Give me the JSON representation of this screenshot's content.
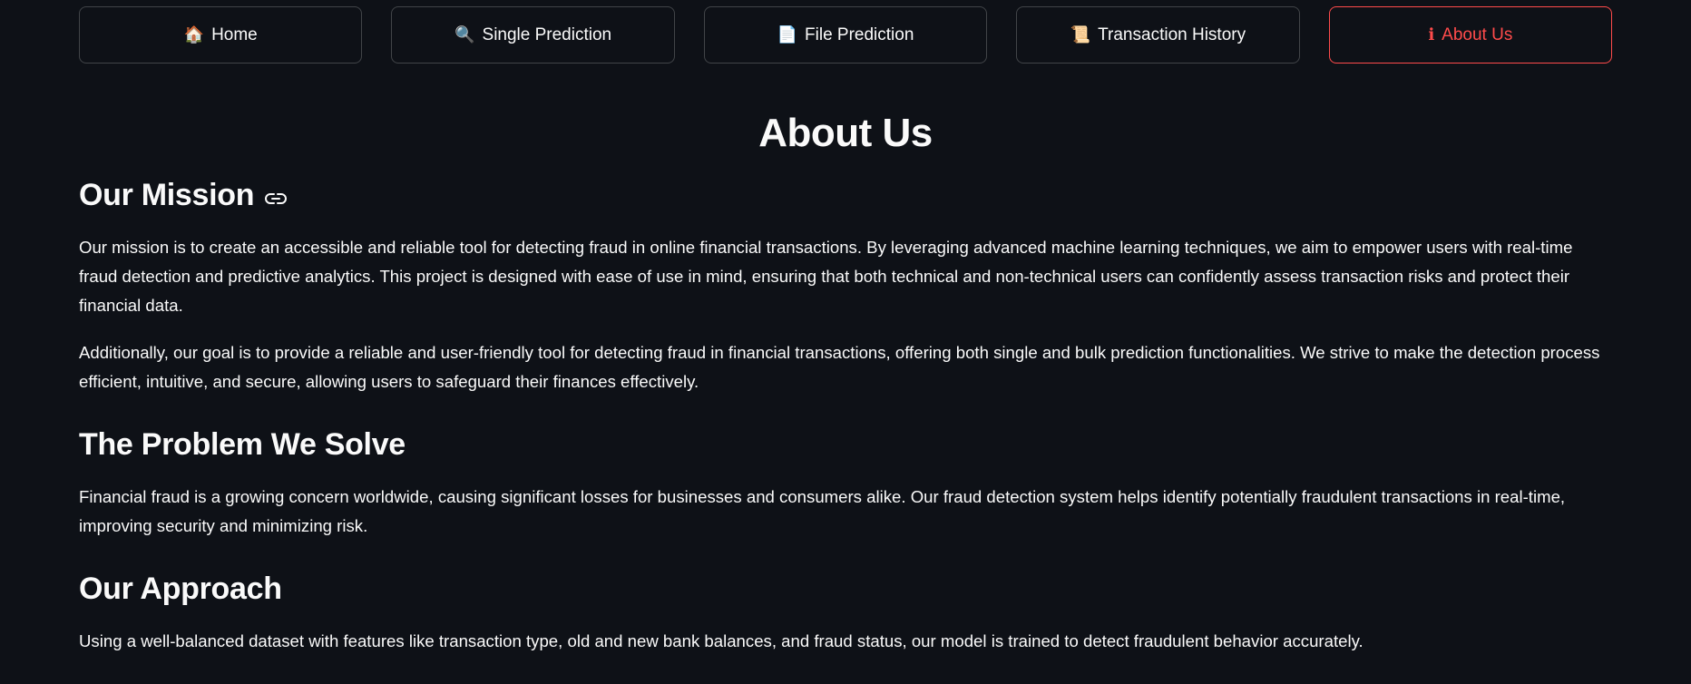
{
  "nav": {
    "items": [
      {
        "icon": "🏠",
        "icon_name": "house-icon",
        "label": "Home",
        "active": false
      },
      {
        "icon": "🔍",
        "icon_name": "magnifier-icon",
        "label": "Single Prediction",
        "active": false
      },
      {
        "icon": "📄",
        "icon_name": "document-icon",
        "label": "File Prediction",
        "active": false
      },
      {
        "icon": "📜",
        "icon_name": "scroll-icon",
        "label": "Transaction History",
        "active": false
      },
      {
        "icon": "ℹ",
        "icon_name": "info-icon",
        "label": "About Us",
        "active": true
      }
    ]
  },
  "colors": {
    "background": "#0e1117",
    "text": "#fafafa",
    "accent": "#ff4b4b",
    "button_border": "rgba(250,250,250,0.22)"
  },
  "page": {
    "title": "About Us"
  },
  "sections": {
    "mission": {
      "heading": "Our Mission",
      "paragraph1": "Our mission is to create an accessible and reliable tool for detecting fraud in online financial transactions. By leveraging advanced machine learning techniques, we aim to empower users with real-time fraud detection and predictive analytics. This project is designed with ease of use in mind, ensuring that both technical and non-technical users can confidently assess transaction risks and protect their financial data.",
      "paragraph2": "Additionally, our goal is to provide a reliable and user-friendly tool for detecting fraud in financial transactions, offering both single and bulk prediction functionalities. We strive to make the detection process efficient, intuitive, and secure, allowing users to safeguard their finances effectively."
    },
    "problem": {
      "heading": "The Problem We Solve",
      "paragraph": "Financial fraud is a growing concern worldwide, causing significant losses for businesses and consumers alike. Our fraud detection system helps identify potentially fraudulent transactions in real-time, improving security and minimizing risk."
    },
    "approach": {
      "heading": "Our Approach",
      "paragraph": "Using a well-balanced dataset with features like transaction type, old and new bank balances, and fraud status, our model is trained to detect fraudulent behavior accurately."
    }
  }
}
